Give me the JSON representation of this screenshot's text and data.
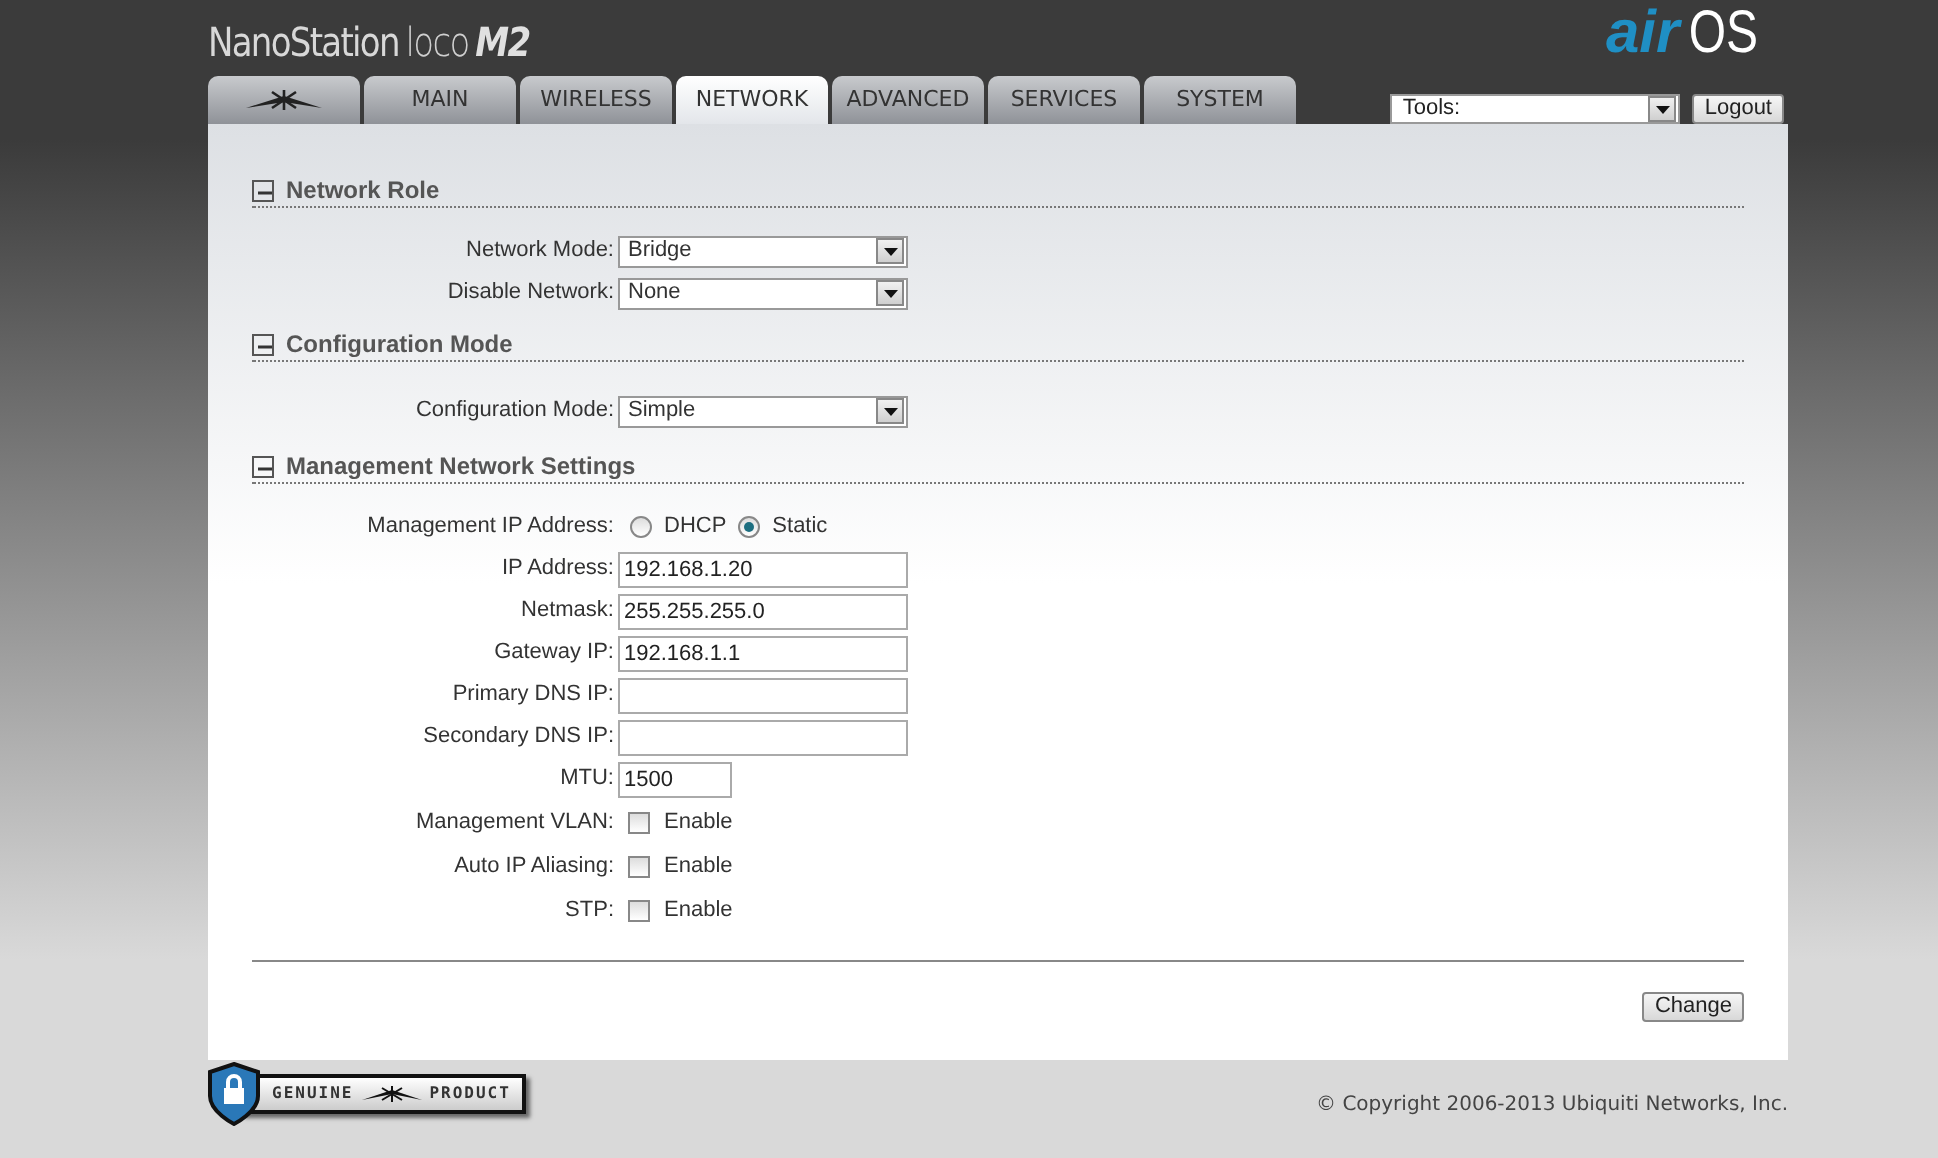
{
  "header": {
    "product_name": "NanoStation",
    "product_model": "loco",
    "product_version": "M2",
    "brand_prefix": "air",
    "brand_suffix": "OS"
  },
  "tabs": [
    {
      "kind": "icon",
      "selected": false
    },
    {
      "label": "MAIN",
      "selected": false
    },
    {
      "label": "WIRELESS",
      "selected": false
    },
    {
      "label": "NETWORK",
      "selected": true
    },
    {
      "label": "ADVANCED",
      "selected": false
    },
    {
      "label": "SERVICES",
      "selected": false
    },
    {
      "label": "SYSTEM",
      "selected": false
    }
  ],
  "tools": {
    "value": "Tools:",
    "button": "Logout"
  },
  "sections": [
    {
      "title": "Network Role",
      "expanded": true,
      "fields": [
        {
          "kind": "select",
          "label": "Network Mode:",
          "value": "Bridge"
        },
        {
          "kind": "select",
          "label": "Disable Network:",
          "value": "None"
        }
      ]
    },
    {
      "title": "Configuration Mode",
      "expanded": true,
      "fields": [
        {
          "kind": "select",
          "label": "Configuration Mode:",
          "value": "Simple"
        }
      ]
    },
    {
      "title": "Management Network Settings",
      "expanded": true,
      "fields": [
        {
          "kind": "radio",
          "label": "Management IP Address:",
          "options": [
            {
              "label": "DHCP",
              "selected": false
            },
            {
              "label": "Static",
              "selected": true
            }
          ]
        },
        {
          "kind": "text",
          "label": "IP Address:",
          "value": "192.168.1.20"
        },
        {
          "kind": "text",
          "label": "Netmask:",
          "value": "255.255.255.0"
        },
        {
          "kind": "text",
          "label": "Gateway IP:",
          "value": "192.168.1.1"
        },
        {
          "kind": "text",
          "label": "Primary DNS IP:"
        },
        {
          "kind": "text",
          "label": "Secondary DNS IP:"
        },
        {
          "kind": "short-text",
          "label": "MTU:",
          "value": "1500"
        },
        {
          "kind": "checkbox",
          "label": "Management VLAN:",
          "option": "Enable",
          "checked": false
        },
        {
          "kind": "checkbox",
          "label": "Auto IP Aliasing:",
          "option": "Enable",
          "checked": false
        },
        {
          "kind": "checkbox",
          "label": "STP:",
          "option": "Enable",
          "checked": false
        }
      ]
    }
  ],
  "change_button": "Change",
  "footer": {
    "badge_left": "GENUINE",
    "badge_right": "PRODUCT",
    "copyright": "© Copyright 2006-2013 Ubiquiti Networks, Inc."
  }
}
